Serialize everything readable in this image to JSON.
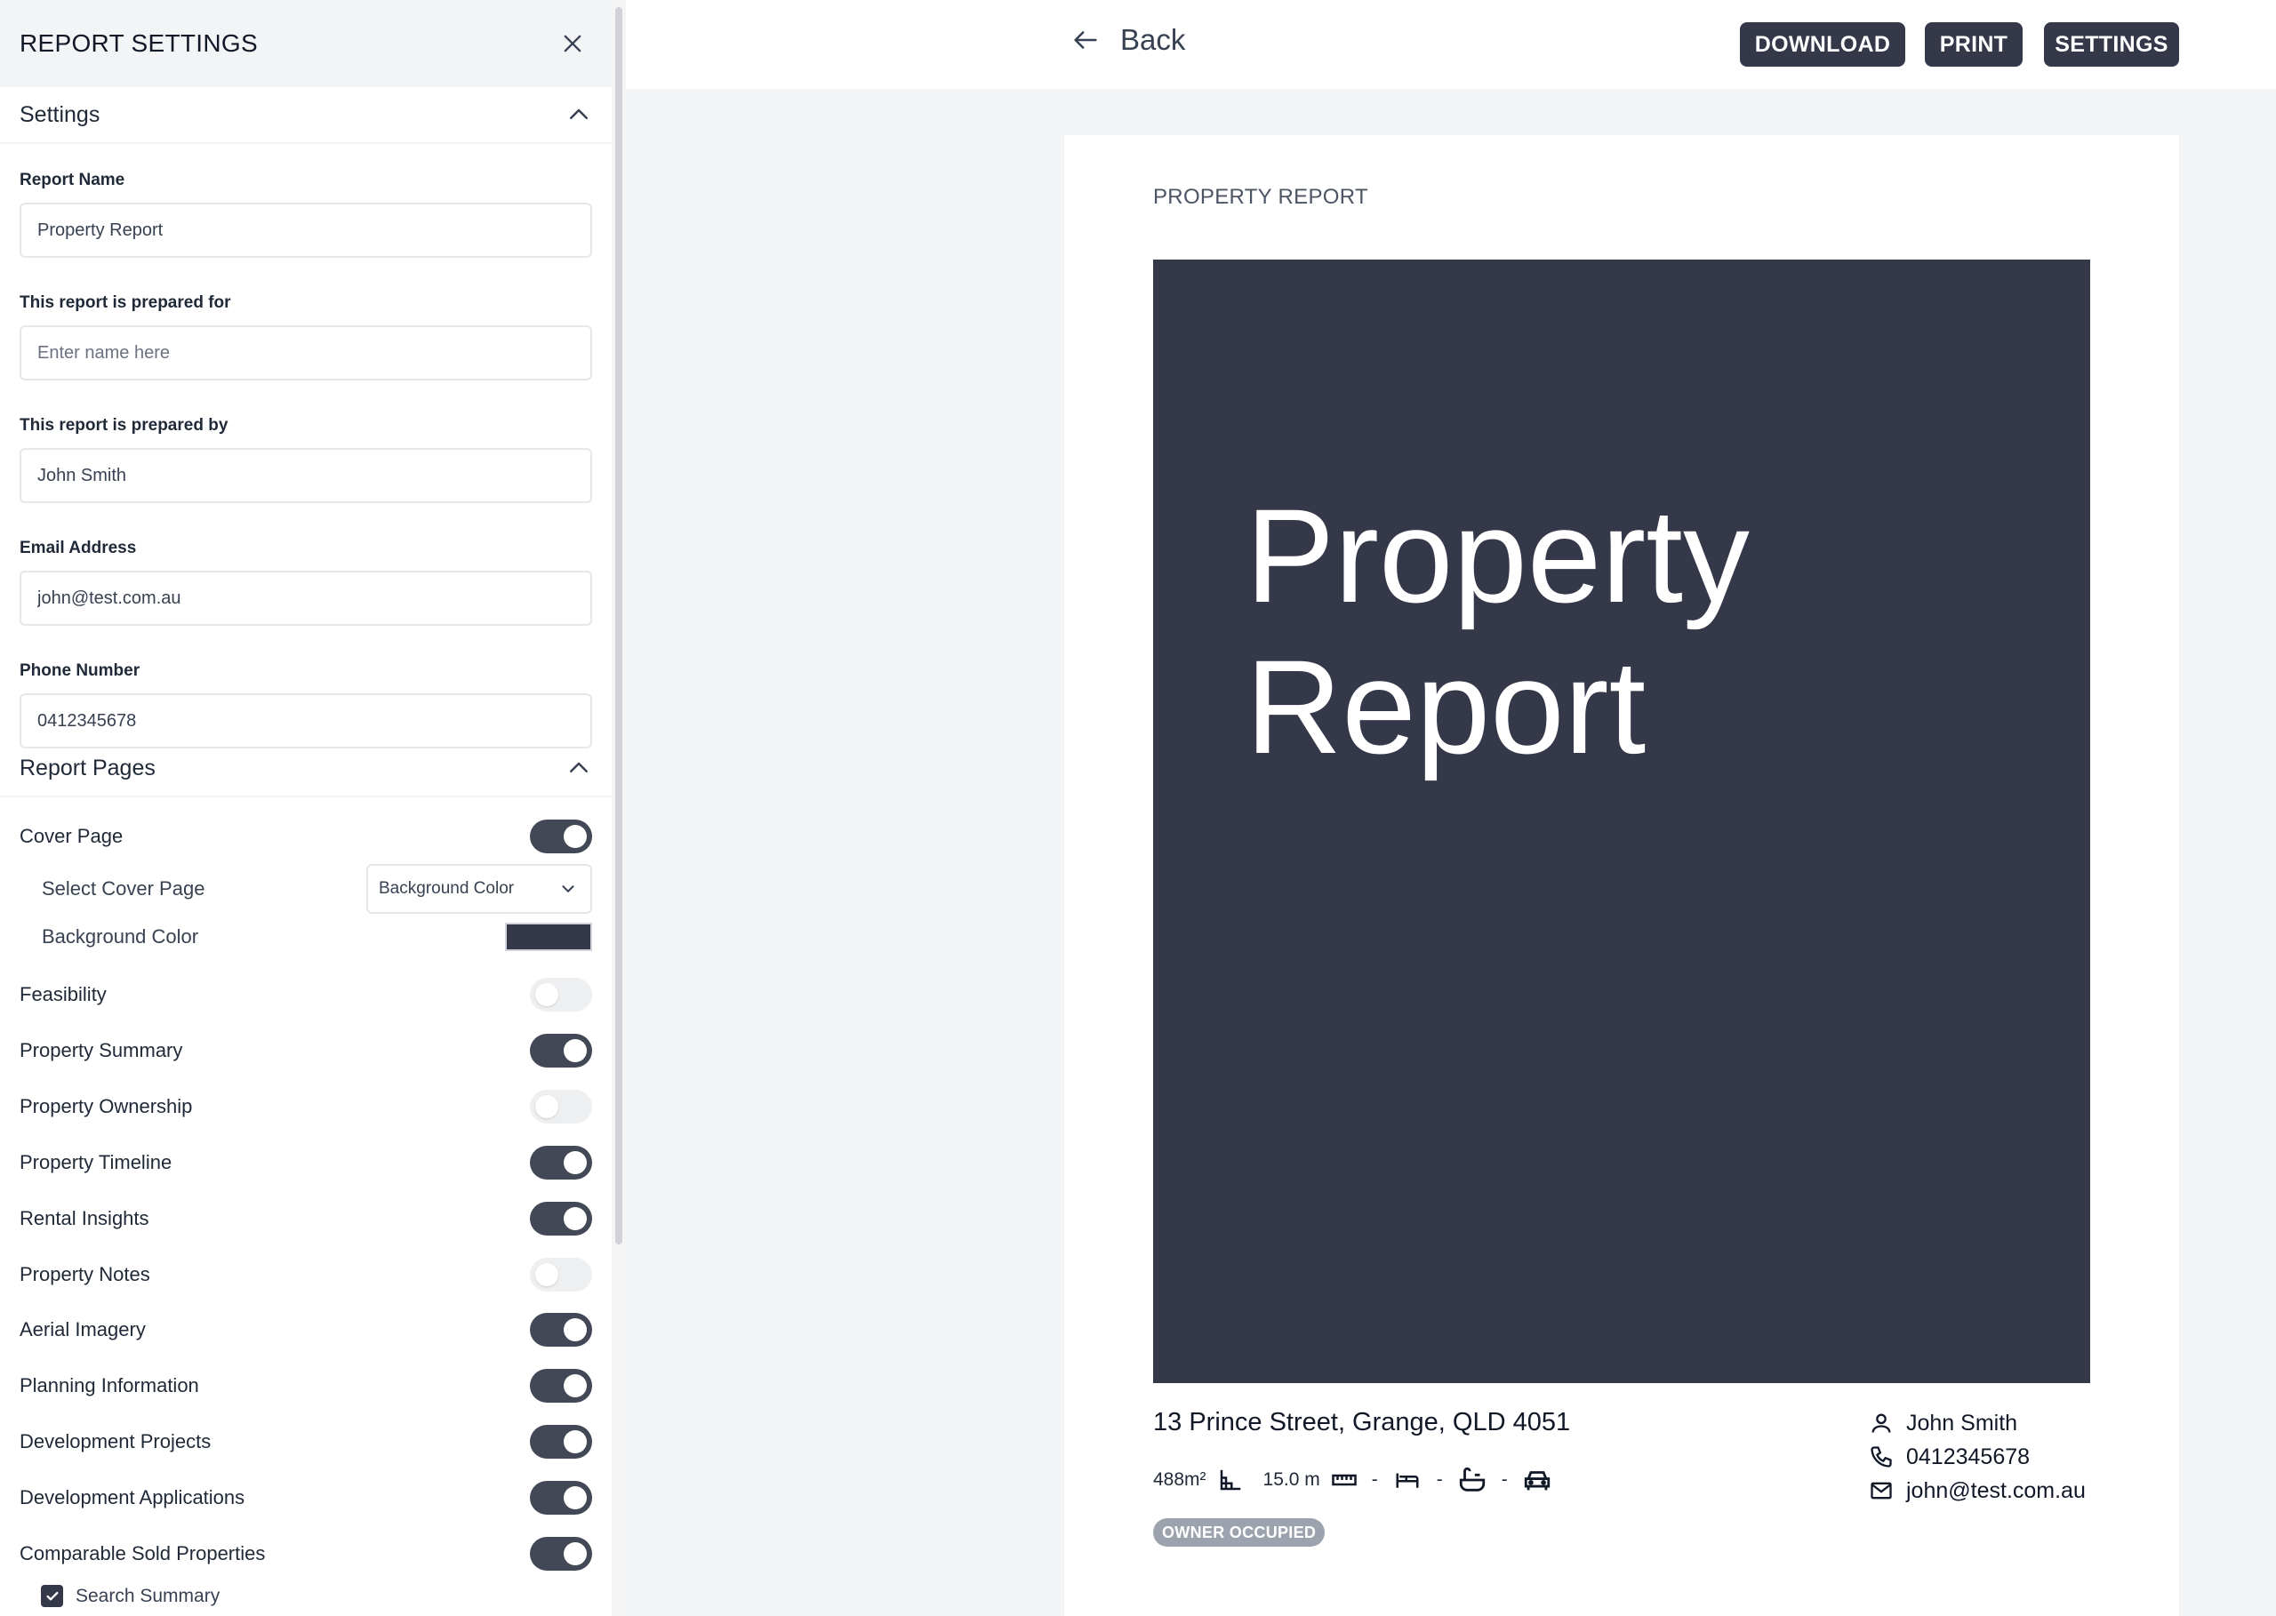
{
  "sidebar": {
    "title": "REPORT SETTINGS",
    "settings_section": "Settings",
    "fields": [
      {
        "label": "Report Name",
        "value": "Property Report",
        "placeholder": ""
      },
      {
        "label": "This report is prepared for",
        "value": "",
        "placeholder": "Enter name here"
      },
      {
        "label": "This report is prepared by",
        "value": "John Smith",
        "placeholder": ""
      },
      {
        "label": "Email Address",
        "value": "john@test.com.au",
        "placeholder": ""
      },
      {
        "label": "Phone Number",
        "value": "0412345678",
        "placeholder": ""
      }
    ],
    "pages_section": "Report Pages",
    "cover": {
      "label": "Cover Page",
      "on": true,
      "select_label": "Select Cover Page",
      "select_value": "Background Color",
      "color_label": "Background Color",
      "color_value": "#343849"
    },
    "pages": [
      {
        "label": "Feasibility",
        "on": false
      },
      {
        "label": "Property Summary",
        "on": true
      },
      {
        "label": "Property Ownership",
        "on": false
      },
      {
        "label": "Property Timeline",
        "on": true
      },
      {
        "label": "Rental Insights",
        "on": true
      },
      {
        "label": "Property Notes",
        "on": false
      },
      {
        "label": "Aerial Imagery",
        "on": true
      },
      {
        "label": "Planning Information",
        "on": true
      },
      {
        "label": "Development Projects",
        "on": true
      },
      {
        "label": "Development Applications",
        "on": true
      },
      {
        "label": "Comparable Sold Properties",
        "on": true
      }
    ],
    "search_summary": {
      "label": "Search Summary",
      "checked": true
    }
  },
  "topbar": {
    "back_label": "Back",
    "download_label": "DOWNLOAD",
    "print_label": "PRINT",
    "settings_label": "SETTINGS"
  },
  "report": {
    "header": "PROPERTY REPORT",
    "cover_title_line1": "Property",
    "cover_title_line2": "Report",
    "address": "13 Prince Street, Grange, QLD 4051",
    "land_area": "488m²",
    "frontage": "15.0 m",
    "beds": "-",
    "baths": "-",
    "cars": "-",
    "badge": "OWNER OCCUPIED",
    "contact_name": "John Smith",
    "contact_phone": "0412345678",
    "contact_email": "john@test.com.au"
  },
  "colors": {
    "accent": "#343849",
    "toggle_on": "#434857",
    "toggle_off": "#eeeff1",
    "badge": "#9ca3af"
  },
  "icons": [
    "close-icon",
    "chevron-up-icon",
    "chevron-down-icon",
    "arrow-left-icon",
    "land-area-icon",
    "ruler-icon",
    "bed-icon",
    "bath-icon",
    "car-icon",
    "user-icon",
    "phone-icon",
    "mail-icon",
    "check-icon"
  ]
}
